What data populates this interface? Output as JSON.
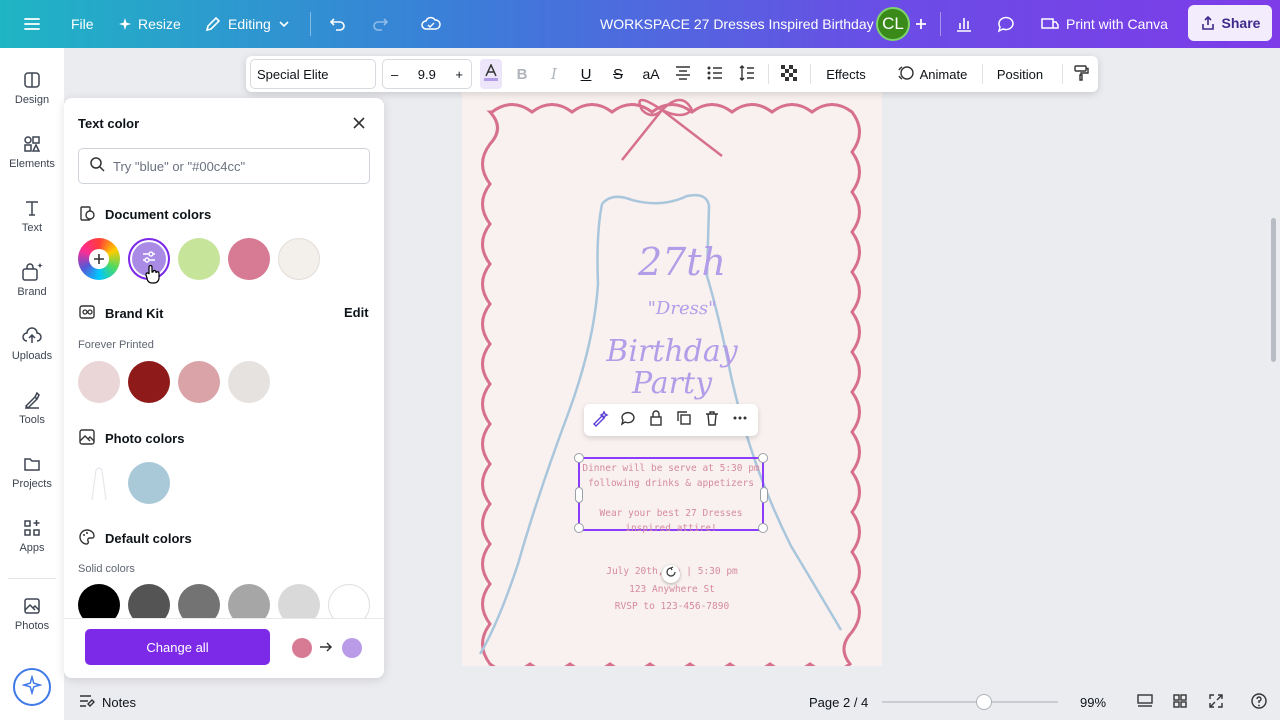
{
  "header": {
    "file_label": "File",
    "resize_label": "Resize",
    "editing_label": "Editing",
    "doc_title": "WORKSPACE 27 Dresses Inspired Birthday",
    "avatar_initials": "CL",
    "print_label": "Print with Canva",
    "share_label": "Share"
  },
  "rail": {
    "items": [
      {
        "label": "Design",
        "icon": "design-icon"
      },
      {
        "label": "Elements",
        "icon": "elements-icon"
      },
      {
        "label": "Text",
        "icon": "text-icon"
      },
      {
        "label": "Brand",
        "icon": "brand-icon"
      },
      {
        "label": "Uploads",
        "icon": "uploads-icon"
      },
      {
        "label": "Tools",
        "icon": "tools-icon"
      },
      {
        "label": "Projects",
        "icon": "projects-icon"
      },
      {
        "label": "Apps",
        "icon": "apps-icon"
      },
      {
        "label": "Photos",
        "icon": "photos-icon"
      }
    ]
  },
  "toolbar": {
    "font": "Special Elite",
    "size": "9.9",
    "minus": "–",
    "plus": "+",
    "effects": "Effects",
    "animate": "Animate",
    "position": "Position"
  },
  "panel": {
    "title": "Text color",
    "search_placeholder": "Try \"blue\" or \"#00c4cc\"",
    "document_colors_label": "Document colors",
    "document_colors": [
      "#a98be6",
      "#c6e49a",
      "#d77a94",
      "#f3efea"
    ],
    "brand_kit_label": "Brand Kit",
    "edit_label": "Edit",
    "brand_name": "Forever Printed",
    "brand_colors": [
      "#ead6d7",
      "#8e1a1a",
      "#d9a3a7",
      "#e5e2e0"
    ],
    "photo_colors_label": "Photo colors",
    "photo_colors": [
      "#a9c8d8"
    ],
    "default_colors_label": "Default colors",
    "solid_colors_label": "Solid colors",
    "solid_colors": [
      "#000000",
      "#545454",
      "#737373",
      "#a6a6a6",
      "#d9d9d9",
      "#ffffff"
    ],
    "change_all_label": "Change all",
    "change_from": "#d77a94",
    "change_to": "#b99be8"
  },
  "canvas": {
    "title_line1": "27th",
    "title_line2": "\"Dress\"",
    "title_line3": "Birthday",
    "title_line4": "Party",
    "body_line1": "Dinner will be serve at 5:30 pm",
    "body_line2": "following drinks & appetizers",
    "body_line3": "Wear your best 27 Dresses",
    "body_line4": "inspired attire!",
    "footer_line1": "July 20th, 2o | 5:30 pm",
    "footer_line2": "123 Anywhere St",
    "footer_line3": "RVSP to  123-456-7890"
  },
  "statusbar": {
    "notes_label": "Notes",
    "page_label": "Page 2 / 4",
    "zoom_label": "99%",
    "zoom_fraction": 0.6
  },
  "colors": {
    "accent": "#7d2ae8",
    "frame_pink": "#d7708c",
    "dress_blue": "#a9c6dc",
    "title_lavender": "#b39ce8"
  }
}
